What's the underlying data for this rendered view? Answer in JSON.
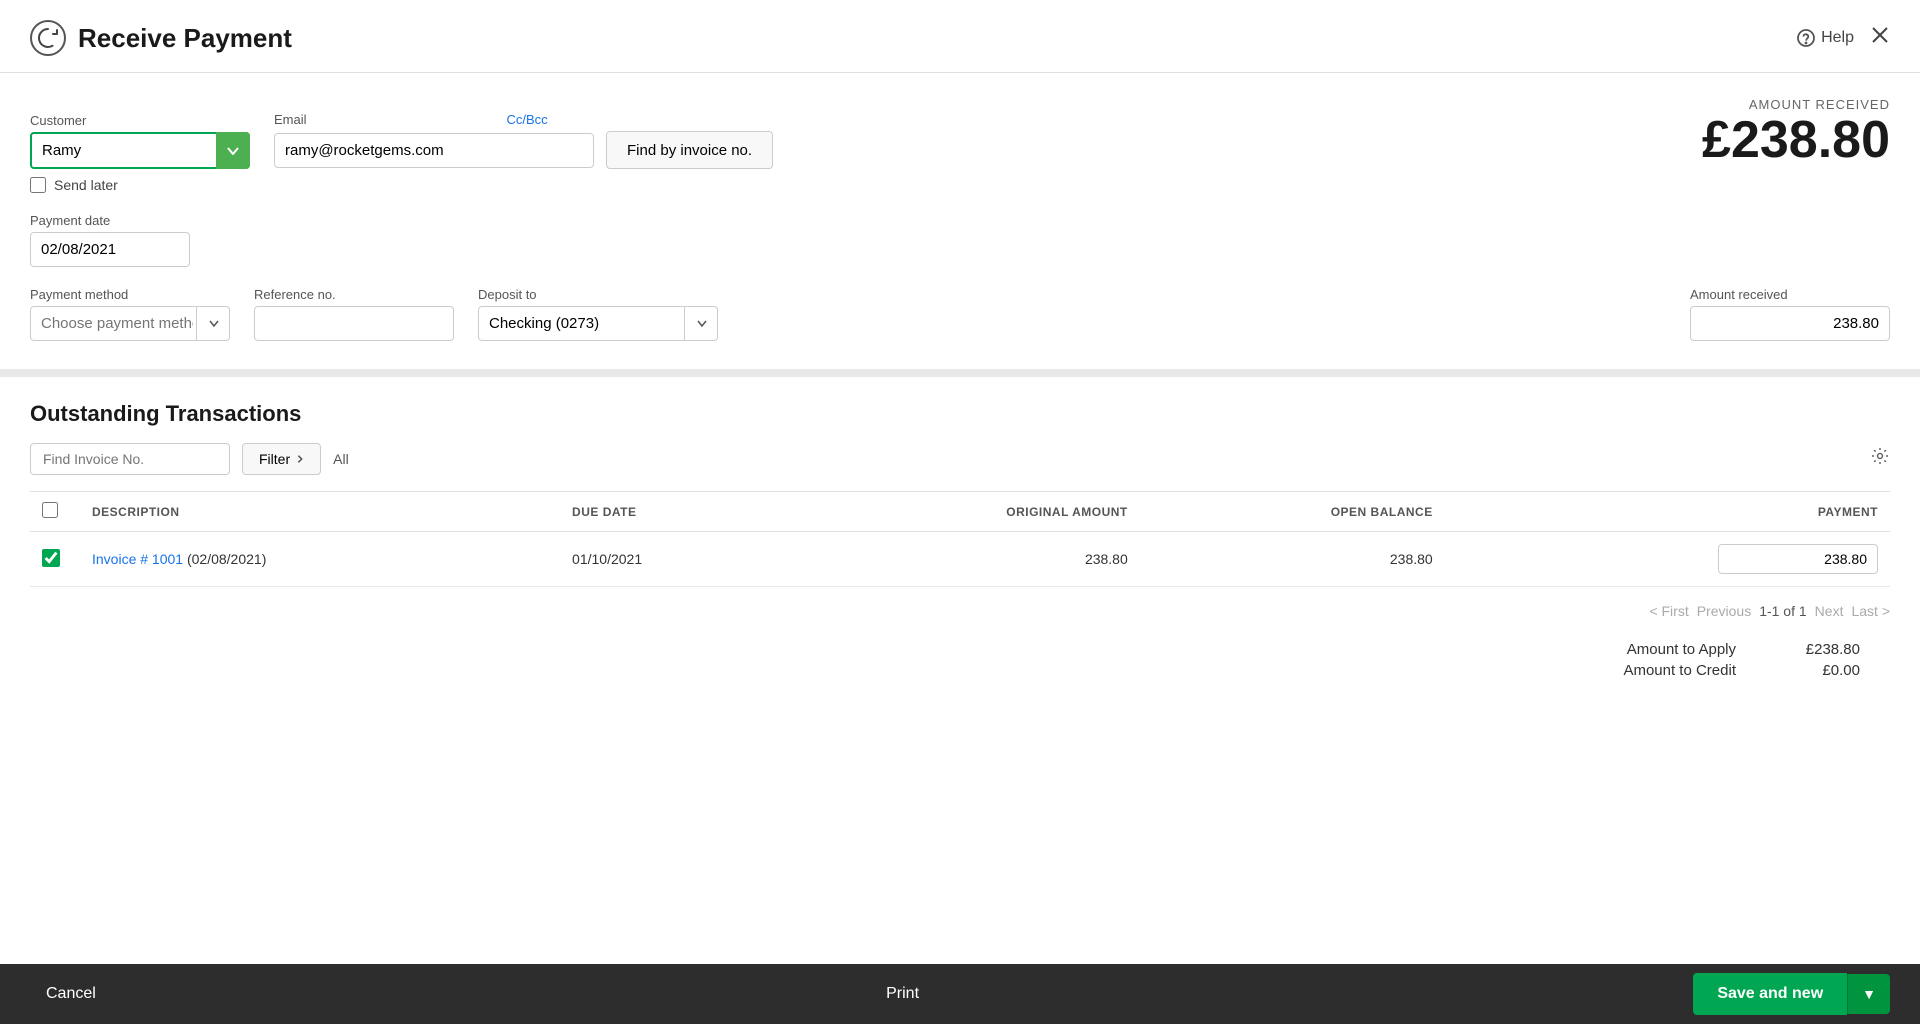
{
  "page": {
    "title": "Receive Payment",
    "icon": "↺"
  },
  "header": {
    "help_label": "Help",
    "close_label": "✕"
  },
  "amount_received": {
    "label": "AMOUNT RECEIVED",
    "value": "£238.80"
  },
  "form": {
    "customer_label": "Customer",
    "customer_value": "Ramy",
    "email_label": "Email",
    "email_value": "ramy@rocketgems.com",
    "cc_bcc_label": "Cc/Bcc",
    "find_invoice_btn": "Find by invoice no.",
    "send_later_label": "Send later",
    "payment_date_label": "Payment date",
    "payment_date_value": "02/08/2021",
    "payment_method_label": "Payment method",
    "payment_method_placeholder": "Choose payment method",
    "reference_label": "Reference no.",
    "reference_value": "",
    "deposit_label": "Deposit to",
    "deposit_value": "Checking (0273)",
    "amount_received_label": "Amount received",
    "amount_received_value": "238.80"
  },
  "transactions": {
    "title": "Outstanding Transactions",
    "find_invoice_placeholder": "Find Invoice No.",
    "filter_btn": "Filter",
    "all_label": "All",
    "columns": {
      "description": "DESCRIPTION",
      "due_date": "DUE DATE",
      "original_amount": "ORIGINAL AMOUNT",
      "open_balance": "OPEN BALANCE",
      "payment": "PAYMENT"
    },
    "rows": [
      {
        "checked": true,
        "description_link": "Invoice # 1001",
        "description_suffix": "(02/08/2021)",
        "due_date": "01/10/2021",
        "original_amount": "238.80",
        "open_balance": "238.80",
        "payment": "238.80"
      }
    ]
  },
  "pagination": {
    "first_label": "< First",
    "previous_label": "Previous",
    "current": "1-1 of 1",
    "next_label": "Next",
    "last_label": "Last >"
  },
  "summary": {
    "amount_to_apply_label": "Amount to Apply",
    "amount_to_apply_value": "£238.80",
    "amount_to_credit_label": "Amount to Credit",
    "amount_to_credit_value": "£0.00"
  },
  "footer": {
    "cancel_label": "Cancel",
    "print_label": "Print",
    "save_new_label": "Save and new",
    "save_dropdown_icon": "▼"
  }
}
